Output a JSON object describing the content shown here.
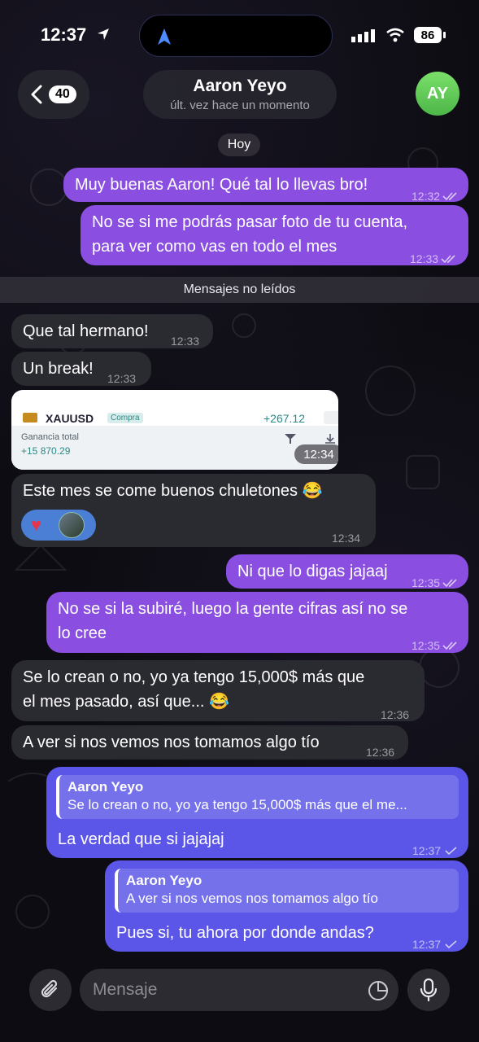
{
  "status": {
    "time": "12:37",
    "battery": "86"
  },
  "header": {
    "back_count": "40",
    "contact_name": "Aaron Yeyo",
    "last_seen": "últ. vez hace un momento",
    "avatar_initials": "AY"
  },
  "date_chip": "Hoy",
  "unread_label": "Mensajes no leídos",
  "messages": [
    {
      "text": "Muy buenas Aaron! Qué tal lo llevas bro!",
      "time": "12:32"
    },
    {
      "line1": "No se si me podrás pasar foto de tu cuenta,",
      "line2": "para ver como vas en todo el mes",
      "time": "12:33"
    },
    {
      "text": "Que tal hermano!",
      "time": "12:33"
    },
    {
      "text": "Un break!",
      "time": "12:33"
    },
    {
      "time": "12:34"
    },
    {
      "text": "Este mes se come buenos chuletones 😂",
      "time": "12:34"
    },
    {
      "text": "Ni que lo digas jajaaj",
      "time": "12:35"
    },
    {
      "line1": "No se si la subiré, luego la gente cifras así no se",
      "line2": "lo cree",
      "time": "12:35"
    },
    {
      "line1": "Se lo crean o no, yo ya tengo 15,000$ más que",
      "line2": "el mes pasado, así que... 😂",
      "time": "12:36"
    },
    {
      "text": "A ver si nos vemos nos tomamos algo tío",
      "time": "12:36"
    },
    {
      "reply_name": "Aaron Yeyo",
      "reply_text": "Se lo crean o no, yo ya tengo 15,000$ más que el me...",
      "text": "La verdad que si jajajaj",
      "time": "12:37"
    },
    {
      "reply_name": "Aaron Yeyo",
      "reply_text": "A ver si nos vemos nos tomamos algo tío",
      "text": "Pues si, tu ahora por donde andas?",
      "time": "12:37"
    }
  ],
  "trade_card": {
    "symbol": "XAUUSD",
    "tag": "Compra",
    "value": "+267.12",
    "label": "Ganancia total",
    "total": "+15 870.29"
  },
  "input": {
    "placeholder": "Mensaje"
  }
}
